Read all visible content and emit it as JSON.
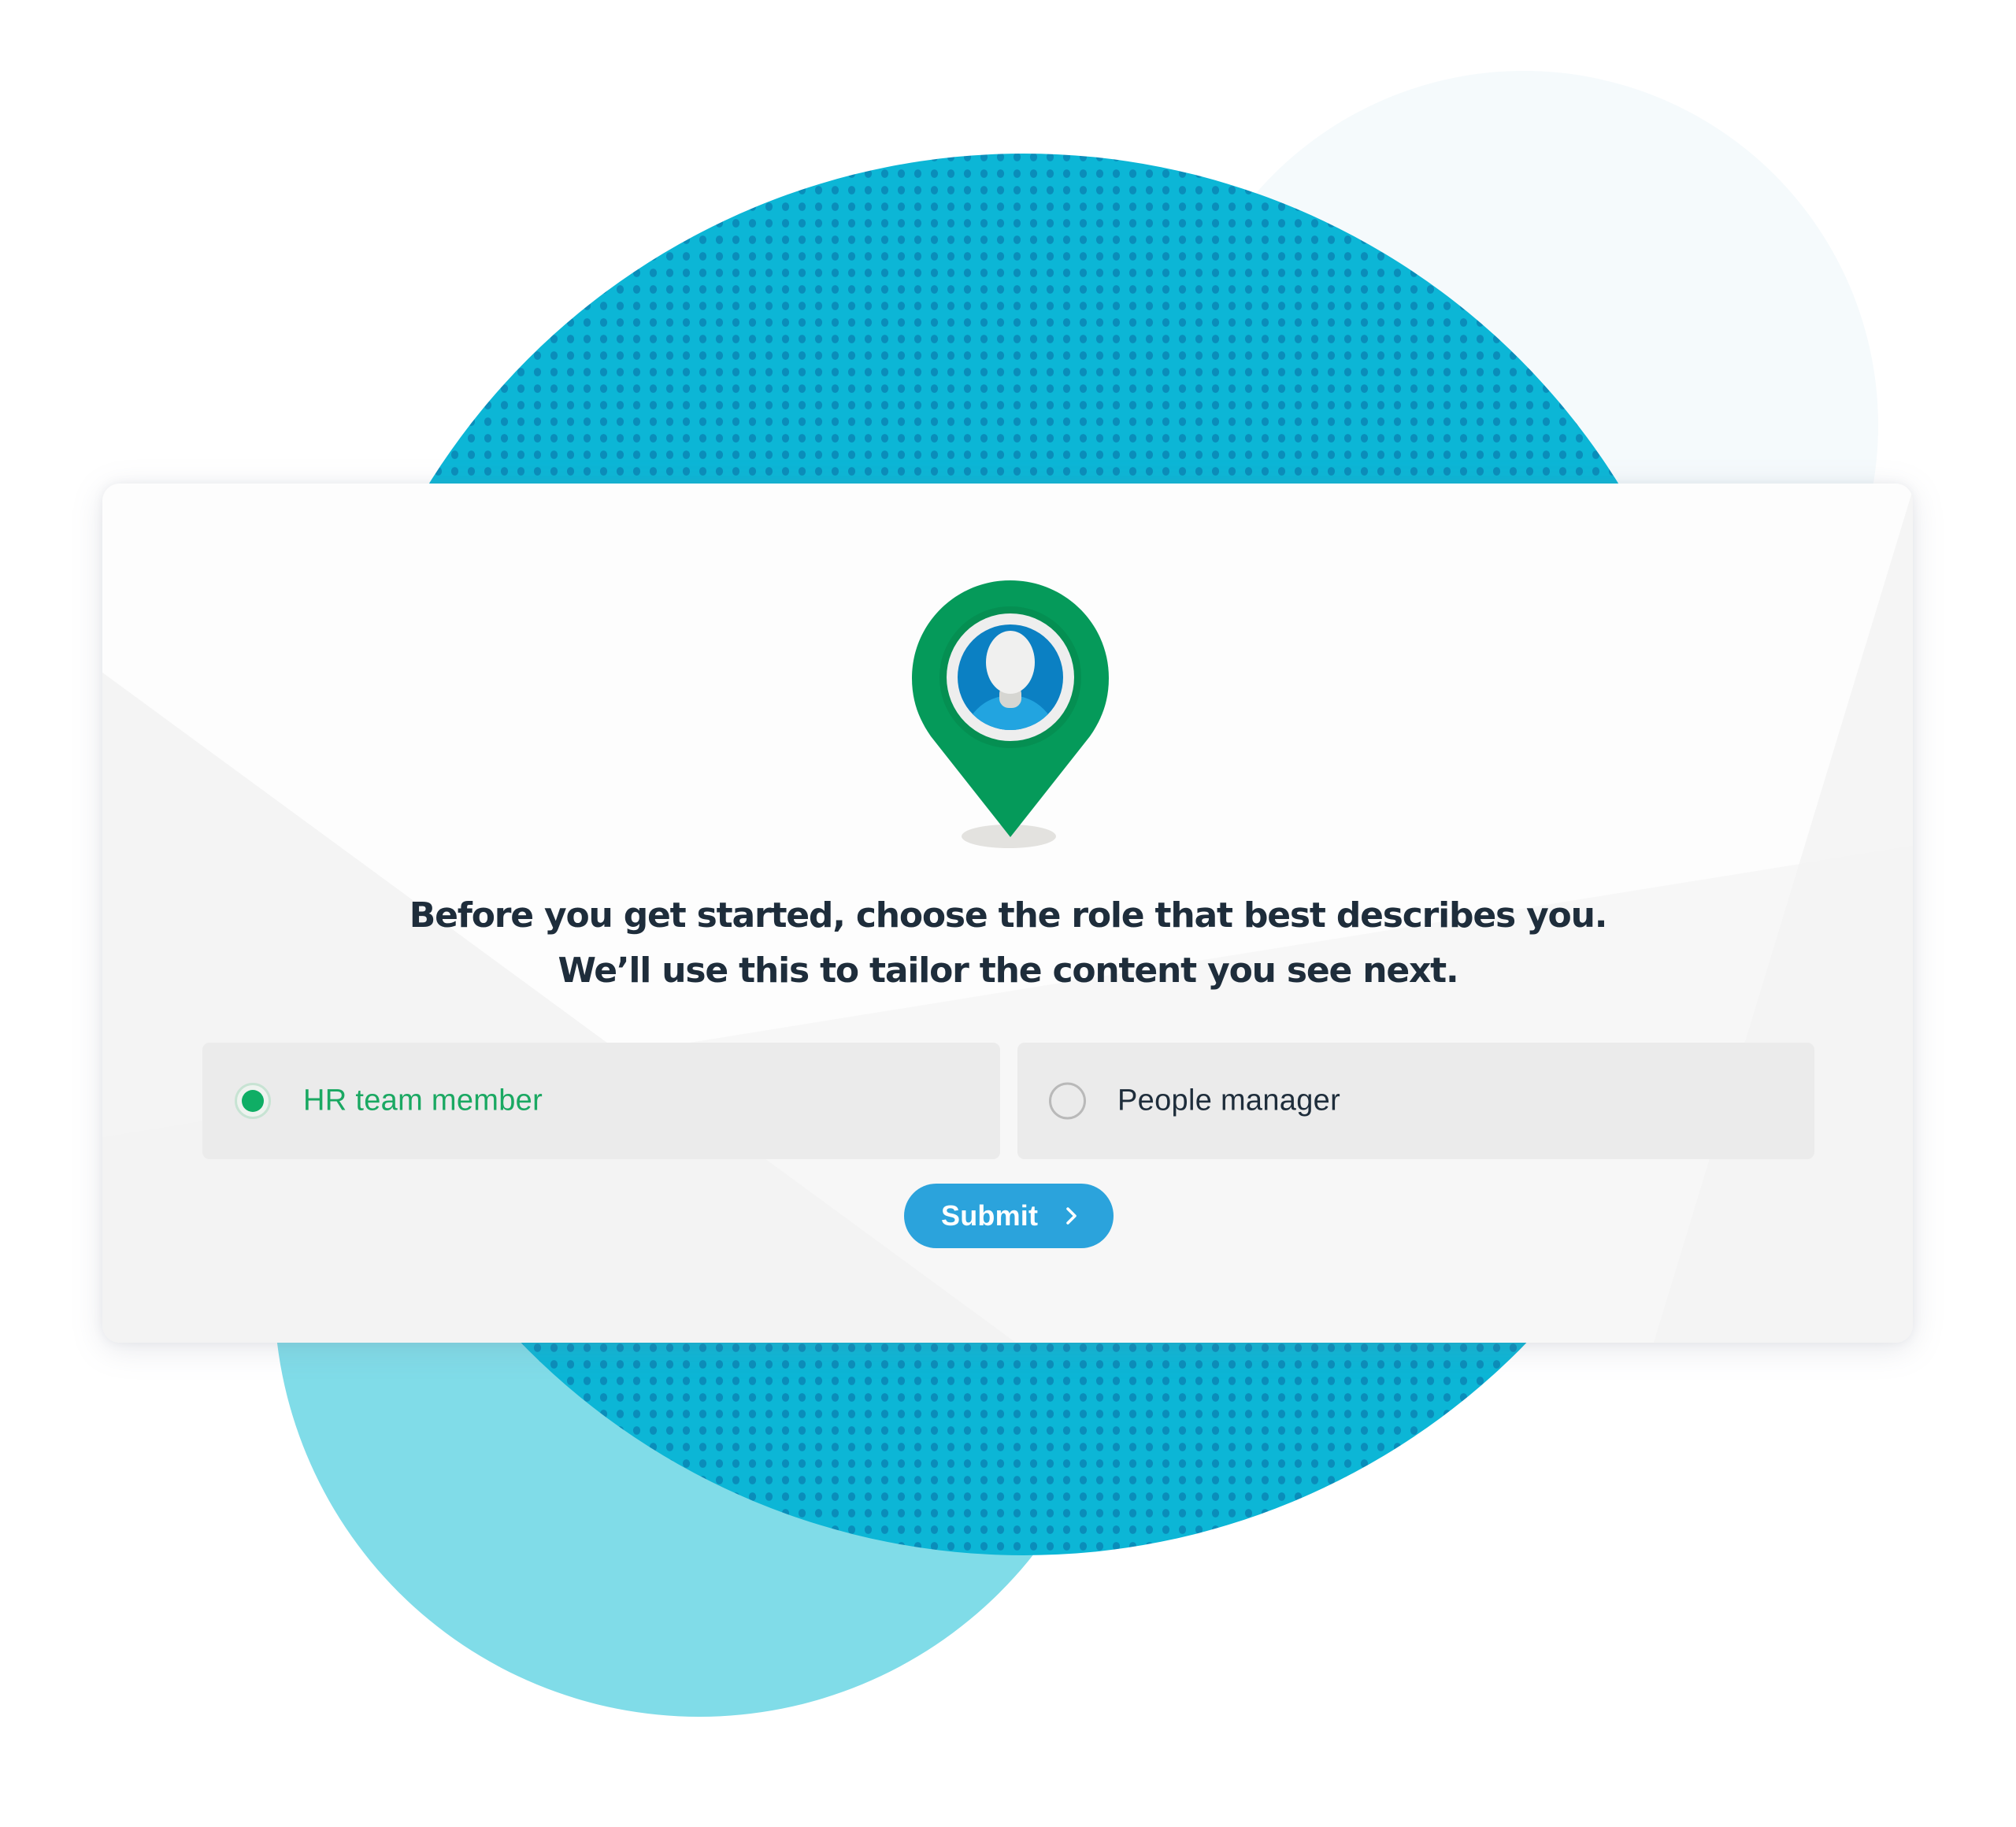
{
  "prompt": {
    "line1": "Before you get started, choose the role that best describes you.",
    "line2": "We’ll use this to tailor the content you see next."
  },
  "illustration": {
    "icon": "location-pin-user-icon"
  },
  "roles": {
    "name": "role",
    "selected": "hr",
    "options": [
      {
        "id": "hr",
        "label": "HR team member",
        "selected": true
      },
      {
        "id": "pm",
        "label": "People manager",
        "selected": false
      }
    ]
  },
  "submit": {
    "label": "Submit",
    "icon": "chevron-right-icon"
  },
  "colors": {
    "accent_green": "#0fae65",
    "selected_text": "#1aa862",
    "button_blue": "#2ba3dc",
    "text_dark": "#1e2d3b",
    "circle_blue": "#0cb6d6",
    "circle_light": "#80dce8"
  }
}
